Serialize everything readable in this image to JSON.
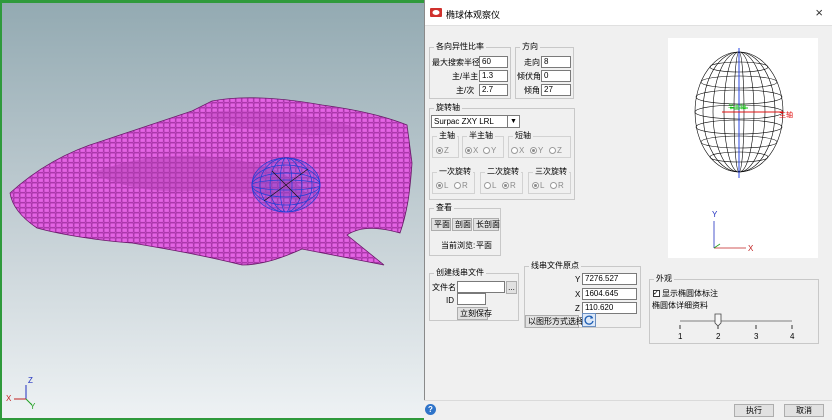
{
  "viewport": {
    "axis_z": "Z",
    "axis_x": "X",
    "axis_y": "Y"
  },
  "dialog": {
    "title": "椭球体观察仪",
    "close": "×",
    "anisotropy": {
      "title": "各向异性比率",
      "max_radius_label": "最大搜索半径",
      "max_radius": "60",
      "major_semi_label": "主/半主",
      "major_semi": "1.3",
      "major_minor_label": "主/次",
      "major_minor": "2.7"
    },
    "direction": {
      "title": "方向",
      "strike_label": "走向",
      "strike": "8",
      "plunge_label": "倾伏角",
      "plunge": "0",
      "dip_label": "倾角",
      "dip": "27"
    },
    "rotation": {
      "title": "旋转轴",
      "combo_value": "Surpac ZXY LRL",
      "main_axis": {
        "title": "主轴",
        "options": [
          "Z"
        ],
        "selected": "Z"
      },
      "semi_axis": {
        "title": "半主轴",
        "options": [
          "X",
          "Y"
        ],
        "selected": "X"
      },
      "minor_axis": {
        "title": "短轴",
        "options": [
          "X",
          "Y",
          "Z"
        ],
        "selected": "Y"
      },
      "first_rot": {
        "title": "一次旋转",
        "options": [
          "L",
          "R"
        ],
        "selected": "L"
      },
      "second_rot": {
        "title": "二次旋转",
        "options": [
          "L",
          "R"
        ],
        "selected": "R"
      },
      "third_rot": {
        "title": "三次旋转",
        "options": [
          "L",
          "R"
        ],
        "selected": "L"
      }
    },
    "view": {
      "title": "查看",
      "buttons": [
        "平面",
        "剖面",
        "长剖面"
      ],
      "current_label": "当前浏览:",
      "current_value": "平面"
    },
    "create_file": {
      "title": "创建线串文件",
      "file_label": "文件名",
      "file_value": "",
      "browse": "...",
      "id_label": "ID",
      "id_value": "",
      "save_now": "立刻保存"
    },
    "origin": {
      "title": "线串文件原点",
      "y_label": "Y",
      "y_value": "7276.527",
      "x_label": "X",
      "x_value": "1604.645",
      "z_label": "Z",
      "z_value": "110.620",
      "pick_button": "以图形方式选择"
    },
    "appearance": {
      "title": "外观",
      "show_label": "显示椭圆体标注",
      "show_checked": true,
      "detail_label": "椭圆体详细资料",
      "slider_ticks": [
        "1",
        "2",
        "3",
        "4"
      ],
      "slider_value": 2
    },
    "preview": {
      "label_major": "主轴",
      "label_semi": "半主轴",
      "axis_y": "Y",
      "axis_x": "X"
    },
    "footer": {
      "help": "?",
      "execute": "执行",
      "cancel": "取消"
    }
  }
}
